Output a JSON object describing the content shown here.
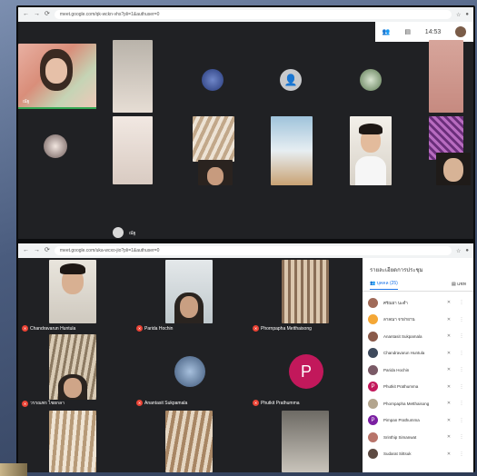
{
  "browser_top": {
    "url": "meet.google.com/qk-wckn-vhs?pli=1&authuser=0"
  },
  "browser_bottom": {
    "url": "meet.google.com/uka-wcxo-jio?pli=1&authuser=0"
  },
  "top_meeting": {
    "time": "14:53",
    "self_label": "ณัฐ",
    "bottom_label": "ณัฐ"
  },
  "bottom_meeting": {
    "tiles": [
      {
        "name": "Chandravarun Huntula"
      },
      {
        "name": "Parida Hochin"
      },
      {
        "name": "Phornpapha Metthaisong"
      },
      {
        "name": "วรรณพร ไชยกลา"
      },
      {
        "name": "Anantasit Sukpamala"
      },
      {
        "name": "Phutkit Prathumma"
      }
    ],
    "p_letter": "P"
  },
  "panel": {
    "title": "รายละเอียดการประชุม",
    "tab_people": "บุคคล (25)",
    "tab_chat": "แชท",
    "participants": [
      {
        "name": "ศรัณยา นะดำ"
      },
      {
        "name": "ลาลณา จาฝาผาน"
      },
      {
        "name": "Anantasit Sukpamala"
      },
      {
        "name": "Chandravarun Huntula"
      },
      {
        "name": "Parida Hochin"
      },
      {
        "name": "Phutkit Prathumma"
      },
      {
        "name": "Phornpapha Metthaisong"
      },
      {
        "name": "Pimpan Prathumma"
      },
      {
        "name": "Srinthip Simanwat"
      },
      {
        "name": "Sudarat Sittsuk"
      }
    ]
  }
}
